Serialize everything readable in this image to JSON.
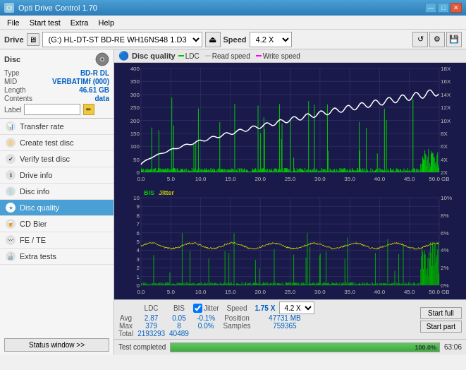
{
  "app": {
    "title": "Opti Drive Control 1.70",
    "icon": "💿"
  },
  "title_bar": {
    "buttons": {
      "minimize": "—",
      "maximize": "□",
      "close": "✕"
    }
  },
  "menu": {
    "items": [
      "File",
      "Start test",
      "Extra",
      "Help"
    ]
  },
  "drive_bar": {
    "label": "Drive",
    "drive_value": "(G:)  HL-DT-ST BD-RE  WH16NS48 1.D3",
    "speed_label": "Speed",
    "speed_value": "4.2 X",
    "eject_icon": "⏏"
  },
  "disc_panel": {
    "title": "Disc",
    "fields": {
      "type_label": "Type",
      "type_value": "BD-R DL",
      "mid_label": "MID",
      "mid_value": "VERBATIMf (000)",
      "length_label": "Length",
      "length_value": "46.61 GB",
      "contents_label": "Contents",
      "contents_value": "data",
      "label_label": "Label"
    }
  },
  "nav": {
    "items": [
      {
        "id": "transfer-rate",
        "label": "Transfer rate",
        "icon": "📊"
      },
      {
        "id": "create-test-disc",
        "label": "Create test disc",
        "icon": "📀"
      },
      {
        "id": "verify-test-disc",
        "label": "Verify test disc",
        "icon": "✔"
      },
      {
        "id": "drive-info",
        "label": "Drive info",
        "icon": "ℹ"
      },
      {
        "id": "disc-info",
        "label": "Disc info",
        "icon": "💿"
      },
      {
        "id": "disc-quality",
        "label": "Disc quality",
        "icon": "★",
        "active": true
      },
      {
        "id": "cd-bier",
        "label": "CD Bier",
        "icon": "🍺"
      },
      {
        "id": "fe-te",
        "label": "FE / TE",
        "icon": "〰"
      },
      {
        "id": "extra-tests",
        "label": "Extra tests",
        "icon": "🔬"
      }
    ],
    "status_btn": "Status window >>"
  },
  "chart": {
    "title": "Disc quality",
    "legend": {
      "ldc_label": "LDC",
      "ldc_color": "#00c000",
      "read_speed_label": "Read speed",
      "read_speed_color": "#ffffff",
      "write_speed_label": "Write speed",
      "write_speed_color": "#ff00ff"
    },
    "upper": {
      "y_max": 400,
      "y_labels": [
        "400",
        "350",
        "300",
        "250",
        "200",
        "150",
        "100",
        "50",
        "0"
      ],
      "y_right_labels": [
        "18X",
        "16X",
        "14X",
        "12X",
        "10X",
        "8X",
        "6X",
        "4X",
        "2X"
      ],
      "x_labels": [
        "0.0",
        "5.0",
        "10.0",
        "15.0",
        "20.0",
        "25.0",
        "30.0",
        "35.0",
        "40.0",
        "45.0",
        "50.0 GB"
      ]
    },
    "lower": {
      "title": "BIS",
      "jitter_label": "Jitter",
      "y_max": 10,
      "y_labels": [
        "10",
        "9",
        "8",
        "7",
        "6",
        "5",
        "4",
        "3",
        "2",
        "1"
      ],
      "y_right_labels": [
        "10%",
        "8%",
        "6%",
        "4%",
        "2%"
      ],
      "x_labels": [
        "0.0",
        "5.0",
        "10.0",
        "15.0",
        "20.0",
        "25.0",
        "30.0",
        "35.0",
        "40.0",
        "45.0",
        "50.0 GB"
      ]
    }
  },
  "stats": {
    "headers": [
      "",
      "LDC",
      "BIS",
      "",
      "Jitter",
      "Speed",
      ""
    ],
    "avg_label": "Avg",
    "avg_ldc": "2.87",
    "avg_bis": "0.05",
    "avg_jitter": "-0.1%",
    "max_label": "Max",
    "max_ldc": "379",
    "max_bis": "8",
    "max_jitter": "0.0%",
    "total_label": "Total",
    "total_ldc": "2193293",
    "total_bis": "40489",
    "speed_value": "1.75 X",
    "speed_combo": "4.2 X",
    "position_label": "Position",
    "position_value": "47731 MB",
    "samples_label": "Samples",
    "samples_value": "759365",
    "start_full_btn": "Start full",
    "start_part_btn": "Start part"
  },
  "progress": {
    "status_text": "Test completed",
    "progress_pct": 100,
    "progress_display": "100.0%",
    "time_text": "63:06"
  }
}
